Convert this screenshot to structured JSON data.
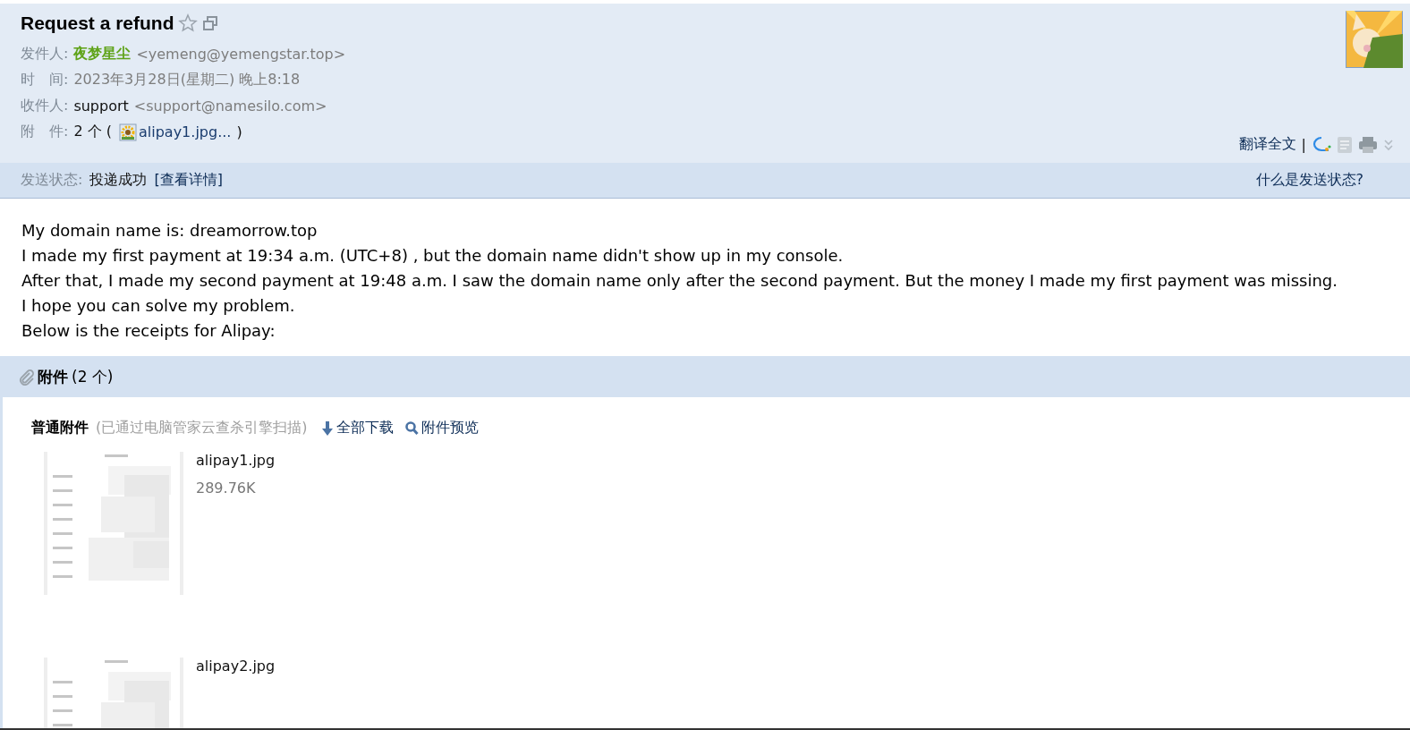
{
  "header": {
    "title": "Request a refund",
    "starred": false,
    "rows": [
      {
        "kind": "sender",
        "label": "发件人:",
        "name": "夜梦星尘",
        "address": "<yemeng@yemengstar.top>"
      },
      {
        "kind": "plain",
        "label": "时　间:",
        "value": "2023年3月28日(星期二) 晚上8:18"
      },
      {
        "kind": "contact",
        "label": "收件人:",
        "name": "support",
        "address": "<support@namesilo.com>"
      },
      {
        "kind": "attach",
        "label": "附　件:",
        "prefix": "2 个 (",
        "file": "alipay1.jpg...",
        "suffix": ")"
      }
    ],
    "tools": {
      "translate": "翻译全文",
      "separator": "|"
    }
  },
  "status": {
    "label": "发送状态:",
    "value": "投递成功",
    "link": "[查看详情]",
    "help": "什么是发送状态?"
  },
  "body": [
    "My domain name is: dreamorrow.top",
    "I made my first payment at 19:34 a.m.  (UTC+8) ,  but the domain name didn't show up in my console.",
    "After that, I made my second payment at 19:48 a.m. I saw the domain name only after the second payment. But the money I made my first payment was missing.",
    "I hope you can solve my problem.",
    "Below is the receipts for Alipay:"
  ],
  "attachments": {
    "title": "附件",
    "count": "(2 个)",
    "section": "普通附件",
    "note": "(已通过电脑管家云查杀引擎扫描)",
    "download_all": "全部下载",
    "preview": "附件预览",
    "items": [
      {
        "name": "alipay1.jpg",
        "size": "289.76K"
      },
      {
        "name": "alipay2.jpg"
      }
    ]
  }
}
